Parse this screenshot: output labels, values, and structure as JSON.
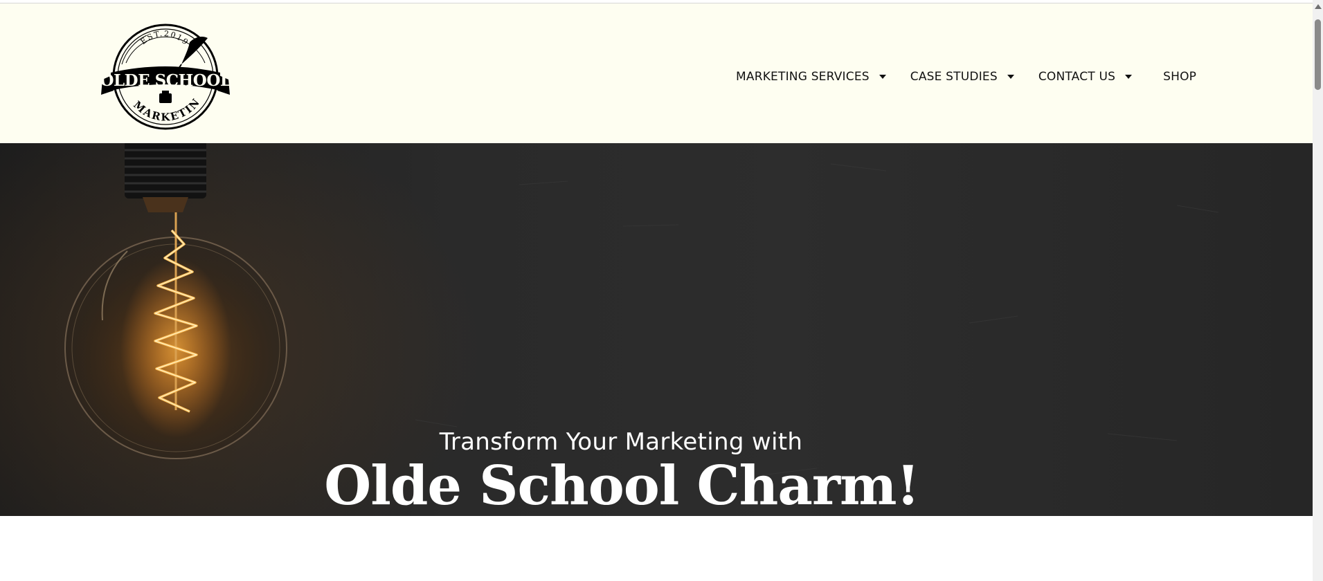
{
  "logo": {
    "est": "EST.2019",
    "line1": "OLDE SCHOOL",
    "line2": "MARKETING"
  },
  "nav": {
    "items": [
      {
        "label": "MARKETING SERVICES",
        "has_dropdown": true
      },
      {
        "label": "CASE STUDIES",
        "has_dropdown": true
      },
      {
        "label": "CONTACT US",
        "has_dropdown": true
      },
      {
        "label": "SHOP",
        "has_dropdown": false
      }
    ]
  },
  "hero": {
    "subtitle": "Transform Your Marketing with",
    "title": "Olde School Charm!"
  },
  "colors": {
    "header_bg": "#fefef1",
    "hero_bg": "#2a2a2a",
    "text_dark": "#111111",
    "text_light": "#ffffff",
    "bulb_glow": "#f5a030"
  },
  "icons": [
    "caret-down-icon",
    "lightbulb-image",
    "scroll-up-arrow-icon"
  ]
}
